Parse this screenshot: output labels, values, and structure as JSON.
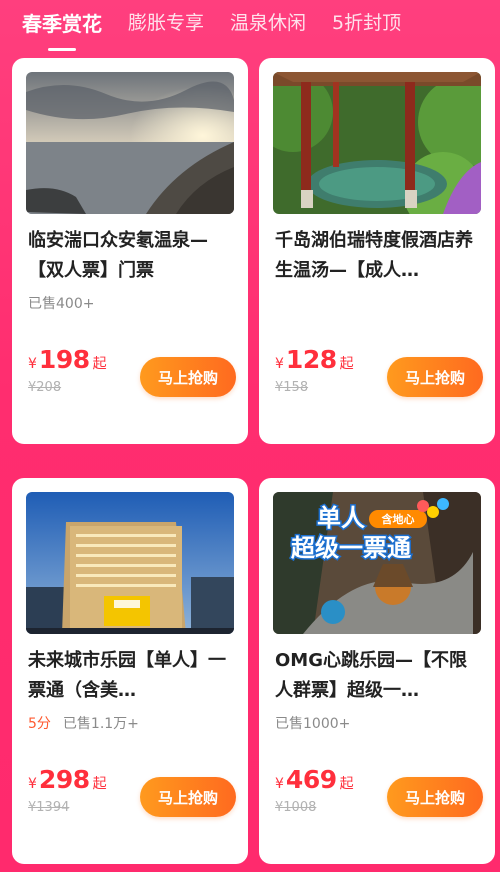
{
  "tabs": [
    {
      "label": "春季赏花",
      "active": true
    },
    {
      "label": "膨胀专享",
      "active": false
    },
    {
      "label": "温泉休闲",
      "active": false
    },
    {
      "label": "5折封顶",
      "active": false
    }
  ],
  "products": [
    {
      "title": "临安湍口众安氡温泉—【双人票】门票",
      "rating": "",
      "sold": "已售400+",
      "currency": "¥",
      "price": "198",
      "price_suffix": "起",
      "original_price": "¥208",
      "buy_label": "马上抢购",
      "image_icon": "seascape-sunset-image"
    },
    {
      "title": "千岛湖伯瑞特度假酒店养生温汤—【成人…",
      "rating": "",
      "sold": "",
      "currency": "¥",
      "price": "128",
      "price_suffix": "起",
      "original_price": "¥158",
      "buy_label": "马上抢购",
      "image_icon": "hot-spring-pavilion-image"
    },
    {
      "title": "未来城市乐园【单人】一票通（含美…",
      "rating": "5分",
      "sold": "已售1.1万+",
      "currency": "¥",
      "price": "298",
      "price_suffix": "起",
      "original_price": "¥1394",
      "buy_label": "马上抢购",
      "image_icon": "city-building-image"
    },
    {
      "title": "OMG心跳乐园—【不限人群票】超级一…",
      "rating": "",
      "sold": "已售1000+",
      "currency": "¥",
      "price": "469",
      "price_suffix": "起",
      "original_price": "¥1008",
      "buy_label": "马上抢购",
      "image_icon": "theme-park-poster-image",
      "image_text": {
        "line1": "单人",
        "badge": "含地心",
        "line2": "超级一票通"
      }
    }
  ]
}
